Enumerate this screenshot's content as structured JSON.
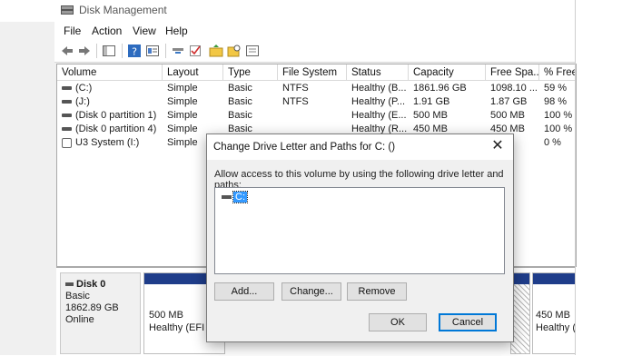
{
  "window": {
    "title": "Disk Management"
  },
  "menu": [
    "File",
    "Action",
    "View",
    "Help"
  ],
  "columns": [
    "Volume",
    "Layout",
    "Type",
    "File System",
    "Status",
    "Capacity",
    "Free Spa...",
    "% Free"
  ],
  "volumes": [
    {
      "name": "(C:)",
      "layout": "Simple",
      "type": "Basic",
      "fs": "NTFS",
      "status": "Healthy (B...",
      "capacity": "1861.96 GB",
      "free": "1098.10 ...",
      "pct": "59 %",
      "icon": "drive-icon"
    },
    {
      "name": "(J:)",
      "layout": "Simple",
      "type": "Basic",
      "fs": "NTFS",
      "status": "Healthy (P...",
      "capacity": "1.91 GB",
      "free": "1.87 GB",
      "pct": "98 %",
      "icon": "drive-icon"
    },
    {
      "name": "(Disk 0 partition 1)",
      "layout": "Simple",
      "type": "Basic",
      "fs": "",
      "status": "Healthy (E...",
      "capacity": "500 MB",
      "free": "500 MB",
      "pct": "100 %",
      "icon": "drive-icon"
    },
    {
      "name": "(Disk 0 partition 4)",
      "layout": "Simple",
      "type": "Basic",
      "fs": "",
      "status": "Healthy (R...",
      "capacity": "450 MB",
      "free": "450 MB",
      "pct": "100 %",
      "icon": "drive-icon"
    },
    {
      "name": "U3 System (I:)",
      "layout": "Simple",
      "type": "",
      "fs": "",
      "status": "",
      "capacity": "",
      "free": "",
      "pct": "0 %",
      "icon": "usb-drive-icon"
    }
  ],
  "disk": {
    "name": "Disk 0",
    "type": "Basic",
    "size": "1862.89 GB",
    "status": "Online"
  },
  "partitions": [
    {
      "size": "500 MB",
      "status": "Healthy (EFI S"
    },
    {
      "size": "450 MB",
      "status": "Healthy ("
    }
  ],
  "dialog": {
    "title": "Change Drive Letter and Paths for C: ()",
    "description": "Allow access to this volume by using the following drive letter and paths:",
    "selected_entry": "C:",
    "buttons": {
      "add": "Add...",
      "change": "Change...",
      "remove": "Remove",
      "ok": "OK",
      "cancel": "Cancel"
    }
  },
  "colors": {
    "partition_bar": "#1f3d8a",
    "selection": "#3399ff",
    "default_button_border": "#0078d7"
  }
}
